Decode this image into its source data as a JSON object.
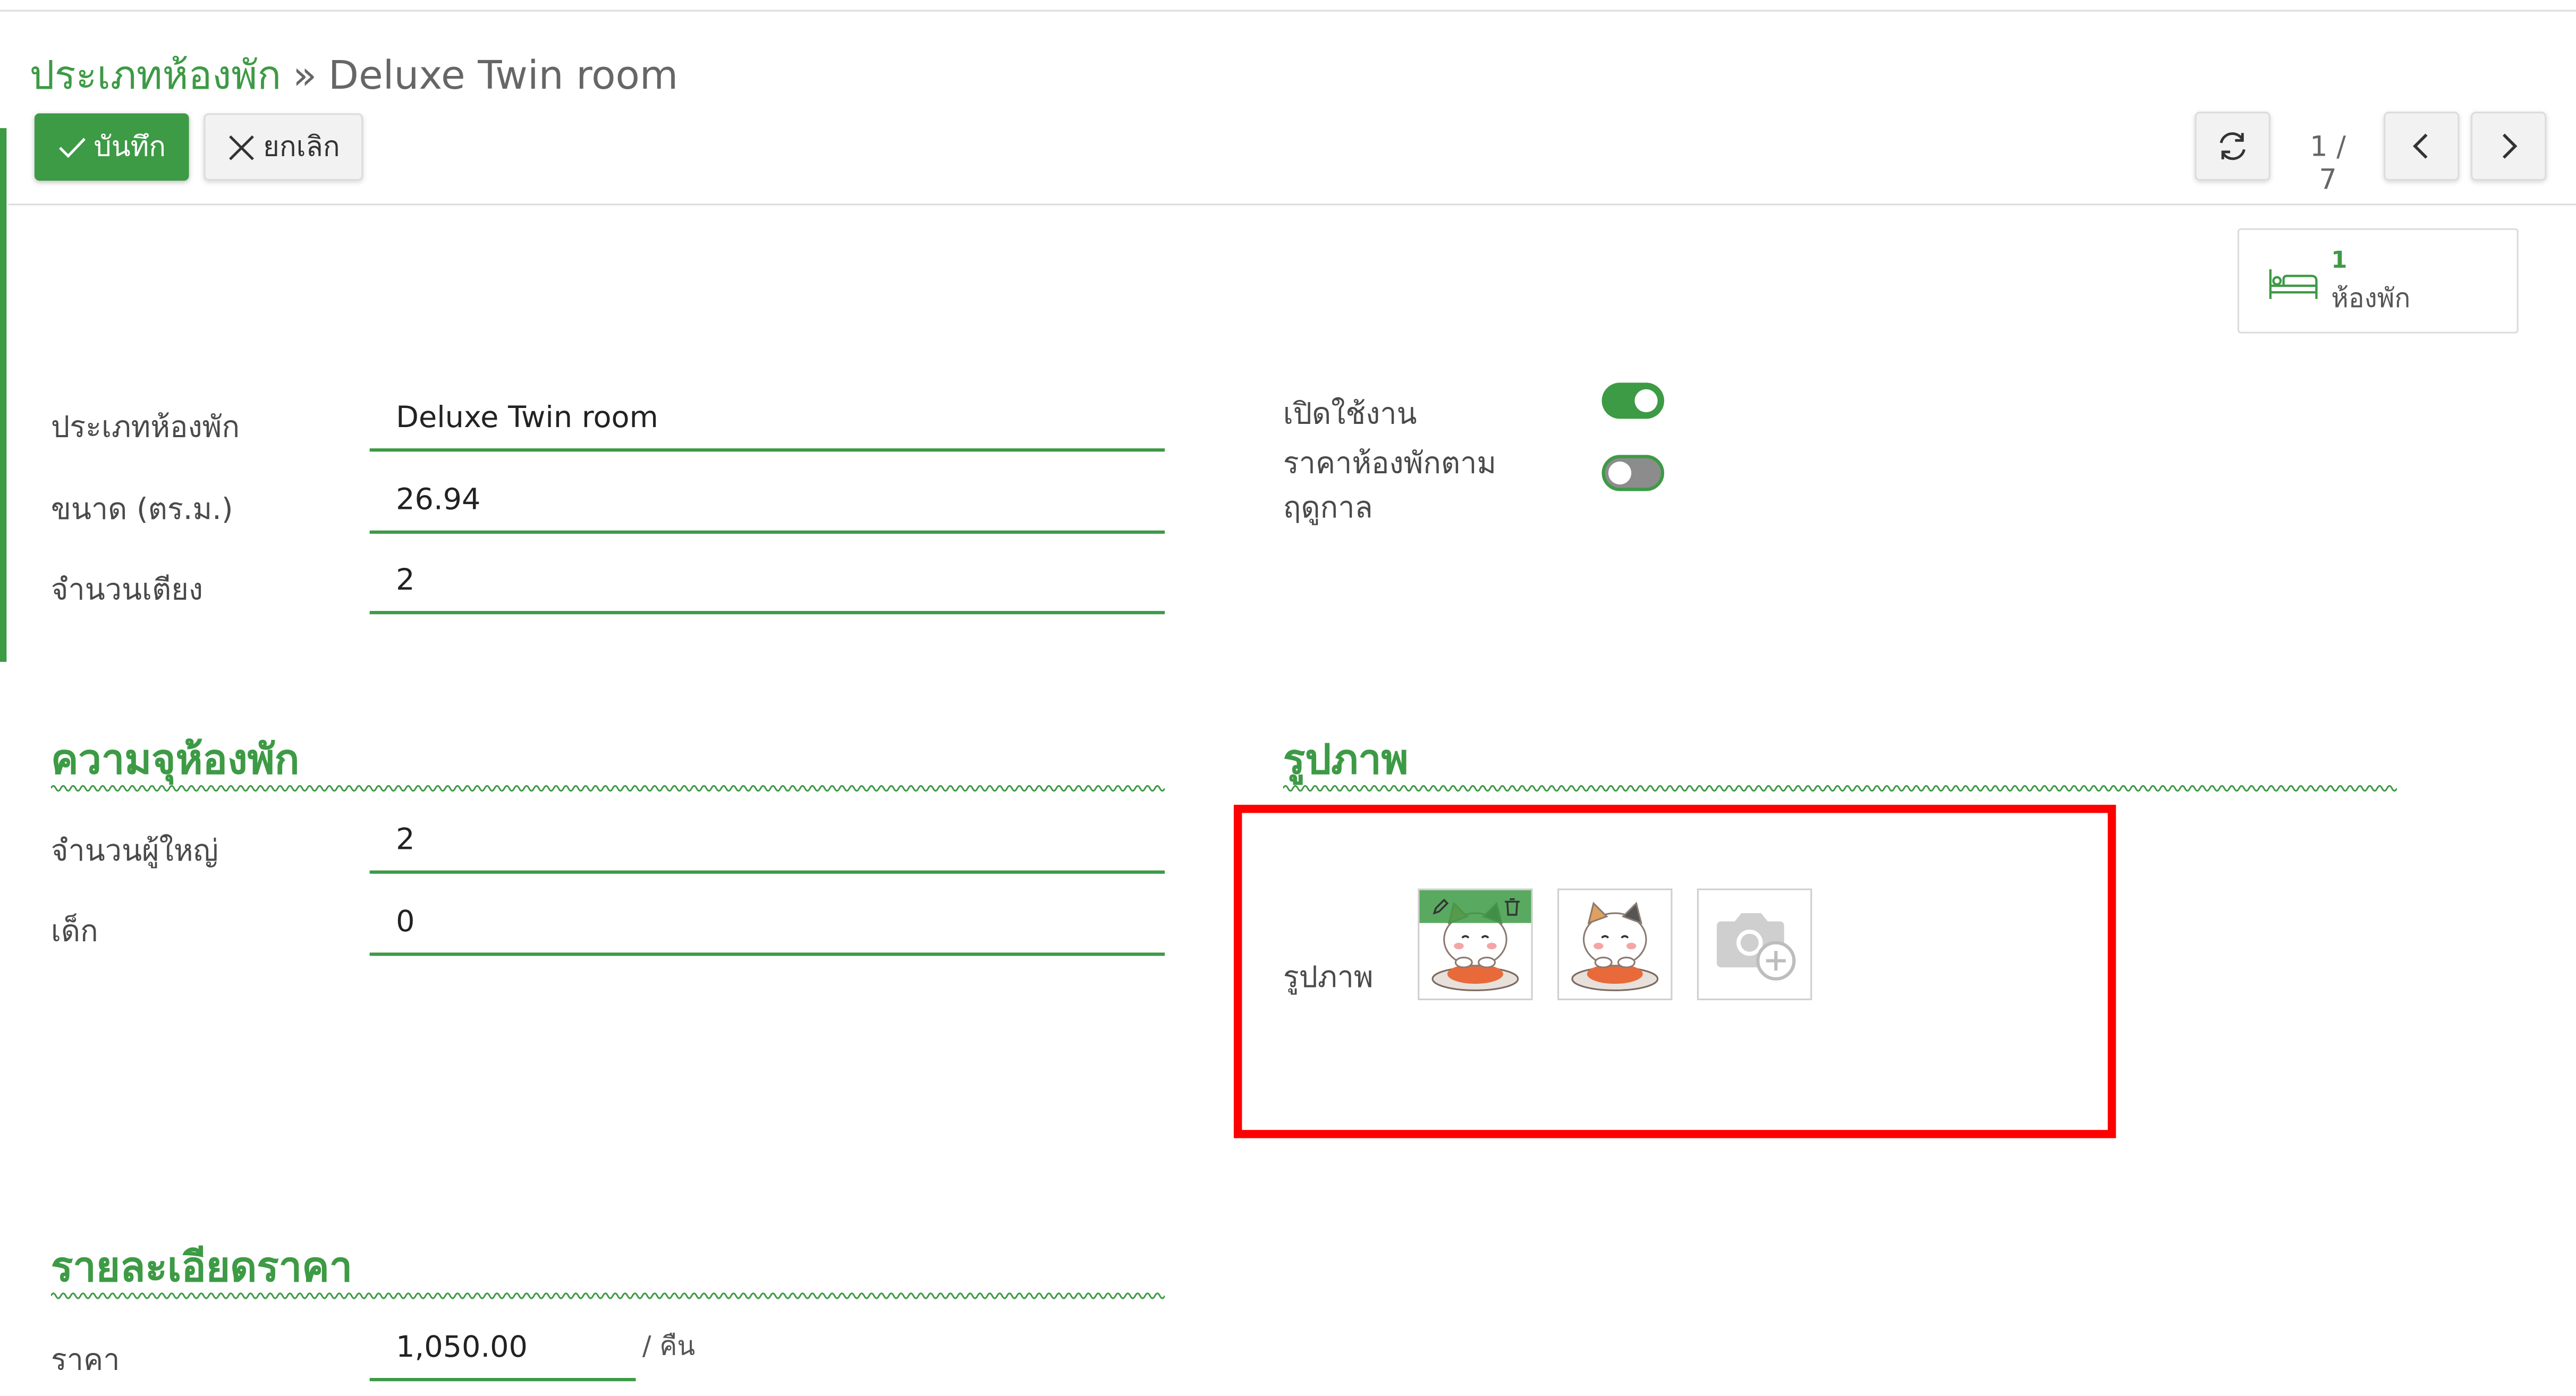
{
  "breadcrumb": {
    "parent": "ประเภทห้องพัก",
    "separator": "»",
    "current": "Deluxe Twin room"
  },
  "toolbar": {
    "save_label": "บันทึก",
    "cancel_label": "ยกเลิก"
  },
  "pager": {
    "text": "1 / 7"
  },
  "stat": {
    "count": "1",
    "label": "ห้องพัก"
  },
  "form": {
    "room_type_label": "ประเภทห้องพัก",
    "room_type_value": "Deluxe Twin room",
    "size_label": "ขนาด (ตร.ม.)",
    "size_value": "26.94",
    "beds_label": "จำนวนเตียง",
    "beds_value": "2",
    "active_label": "เปิดใช้งาน",
    "active_on": true,
    "seasonal_label_line1": "ราคาห้องพักตาม",
    "seasonal_label_line2": "ฤดูกาล",
    "seasonal_on": false
  },
  "capacity": {
    "title": "ความจุห้องพัก",
    "adults_label": "จำนวนผู้ใหญ่",
    "adults_value": "2",
    "children_label": "เด็ก",
    "children_value": "0"
  },
  "images": {
    "title": "รูปภาพ",
    "field_label": "รูปภาพ"
  },
  "pricing": {
    "title": "รายละเอียดราคา",
    "price_label": "ราคา",
    "price_value": "1,050.00",
    "unit": "/ คืน"
  },
  "colors": {
    "accent": "#3d9a45",
    "highlight": "#ff0000"
  },
  "icons": [
    "check-icon",
    "close-icon",
    "refresh-icon",
    "chevron-left-icon",
    "chevron-right-icon",
    "bed-icon",
    "edit-icon",
    "trash-icon",
    "camera-add-icon"
  ]
}
